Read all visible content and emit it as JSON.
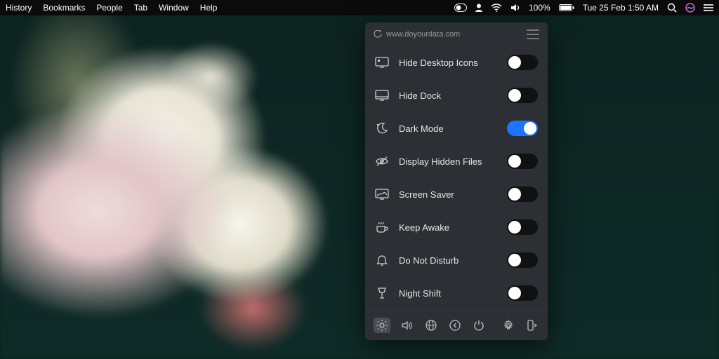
{
  "menubar": {
    "left": [
      "History",
      "Bookmarks",
      "People",
      "Tab",
      "Window",
      "Help"
    ],
    "battery_pct": "100%",
    "clock": "Tue 25 Feb  1:50 AM"
  },
  "panel": {
    "site": "www.doyourdata.com",
    "rows": [
      {
        "key": "hide_desktop_icons",
        "label": "Hide Desktop Icons",
        "icon": "desktop-icon",
        "on": false
      },
      {
        "key": "hide_dock",
        "label": "Hide Dock",
        "icon": "dock-icon",
        "on": false
      },
      {
        "key": "dark_mode",
        "label": "Dark Mode",
        "icon": "moon-icon",
        "on": true
      },
      {
        "key": "display_hidden",
        "label": "Display Hidden Files",
        "icon": "eye-off-icon",
        "on": false
      },
      {
        "key": "screen_saver",
        "label": "Screen Saver",
        "icon": "screensaver-icon",
        "on": false
      },
      {
        "key": "keep_awake",
        "label": "Keep Awake",
        "icon": "coffee-icon",
        "on": false
      },
      {
        "key": "dnd",
        "label": "Do Not Disturb",
        "icon": "bell-icon",
        "on": false
      },
      {
        "key": "night_shift",
        "label": "Night Shift",
        "icon": "lamp-icon",
        "on": false
      }
    ],
    "footer_left": [
      "brightness-icon",
      "volume-icon",
      "globe-icon",
      "back-icon",
      "power-icon"
    ],
    "footer_right": [
      "gear-icon",
      "eject-icon"
    ]
  }
}
